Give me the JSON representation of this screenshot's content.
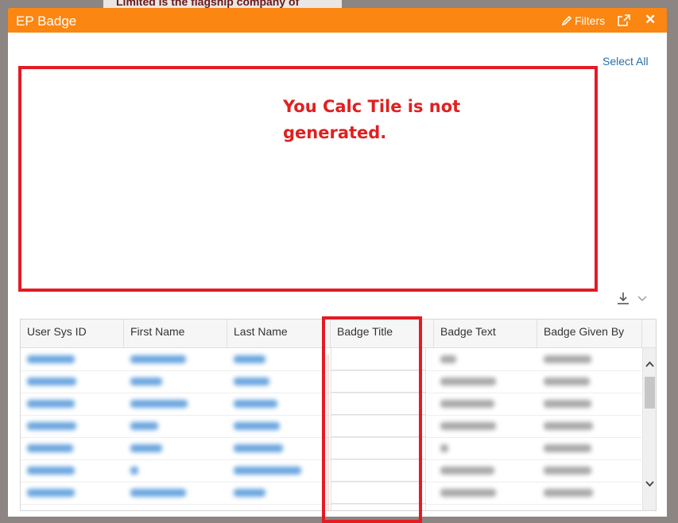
{
  "background": {
    "text": "Limited is the flagship company of"
  },
  "dialog": {
    "title": "EP Badge",
    "filters_label": "Filters",
    "icons": {
      "filters": "pencil-icon",
      "popout": "external-link-icon",
      "close": "close-icon"
    },
    "accent_color": "#fb8612"
  },
  "select_all_label": "Select All",
  "calc_message": "You Calc Tile is not generated.",
  "annotation_color": "#e31b23",
  "download": {
    "icon": "download-icon",
    "menu_icon": "chevron-down-icon"
  },
  "grid": {
    "columns": [
      "User Sys ID",
      "First Name",
      "Last Name",
      "Badge Title",
      "Badge Text",
      "Badge Given By"
    ],
    "row_count": 7
  }
}
